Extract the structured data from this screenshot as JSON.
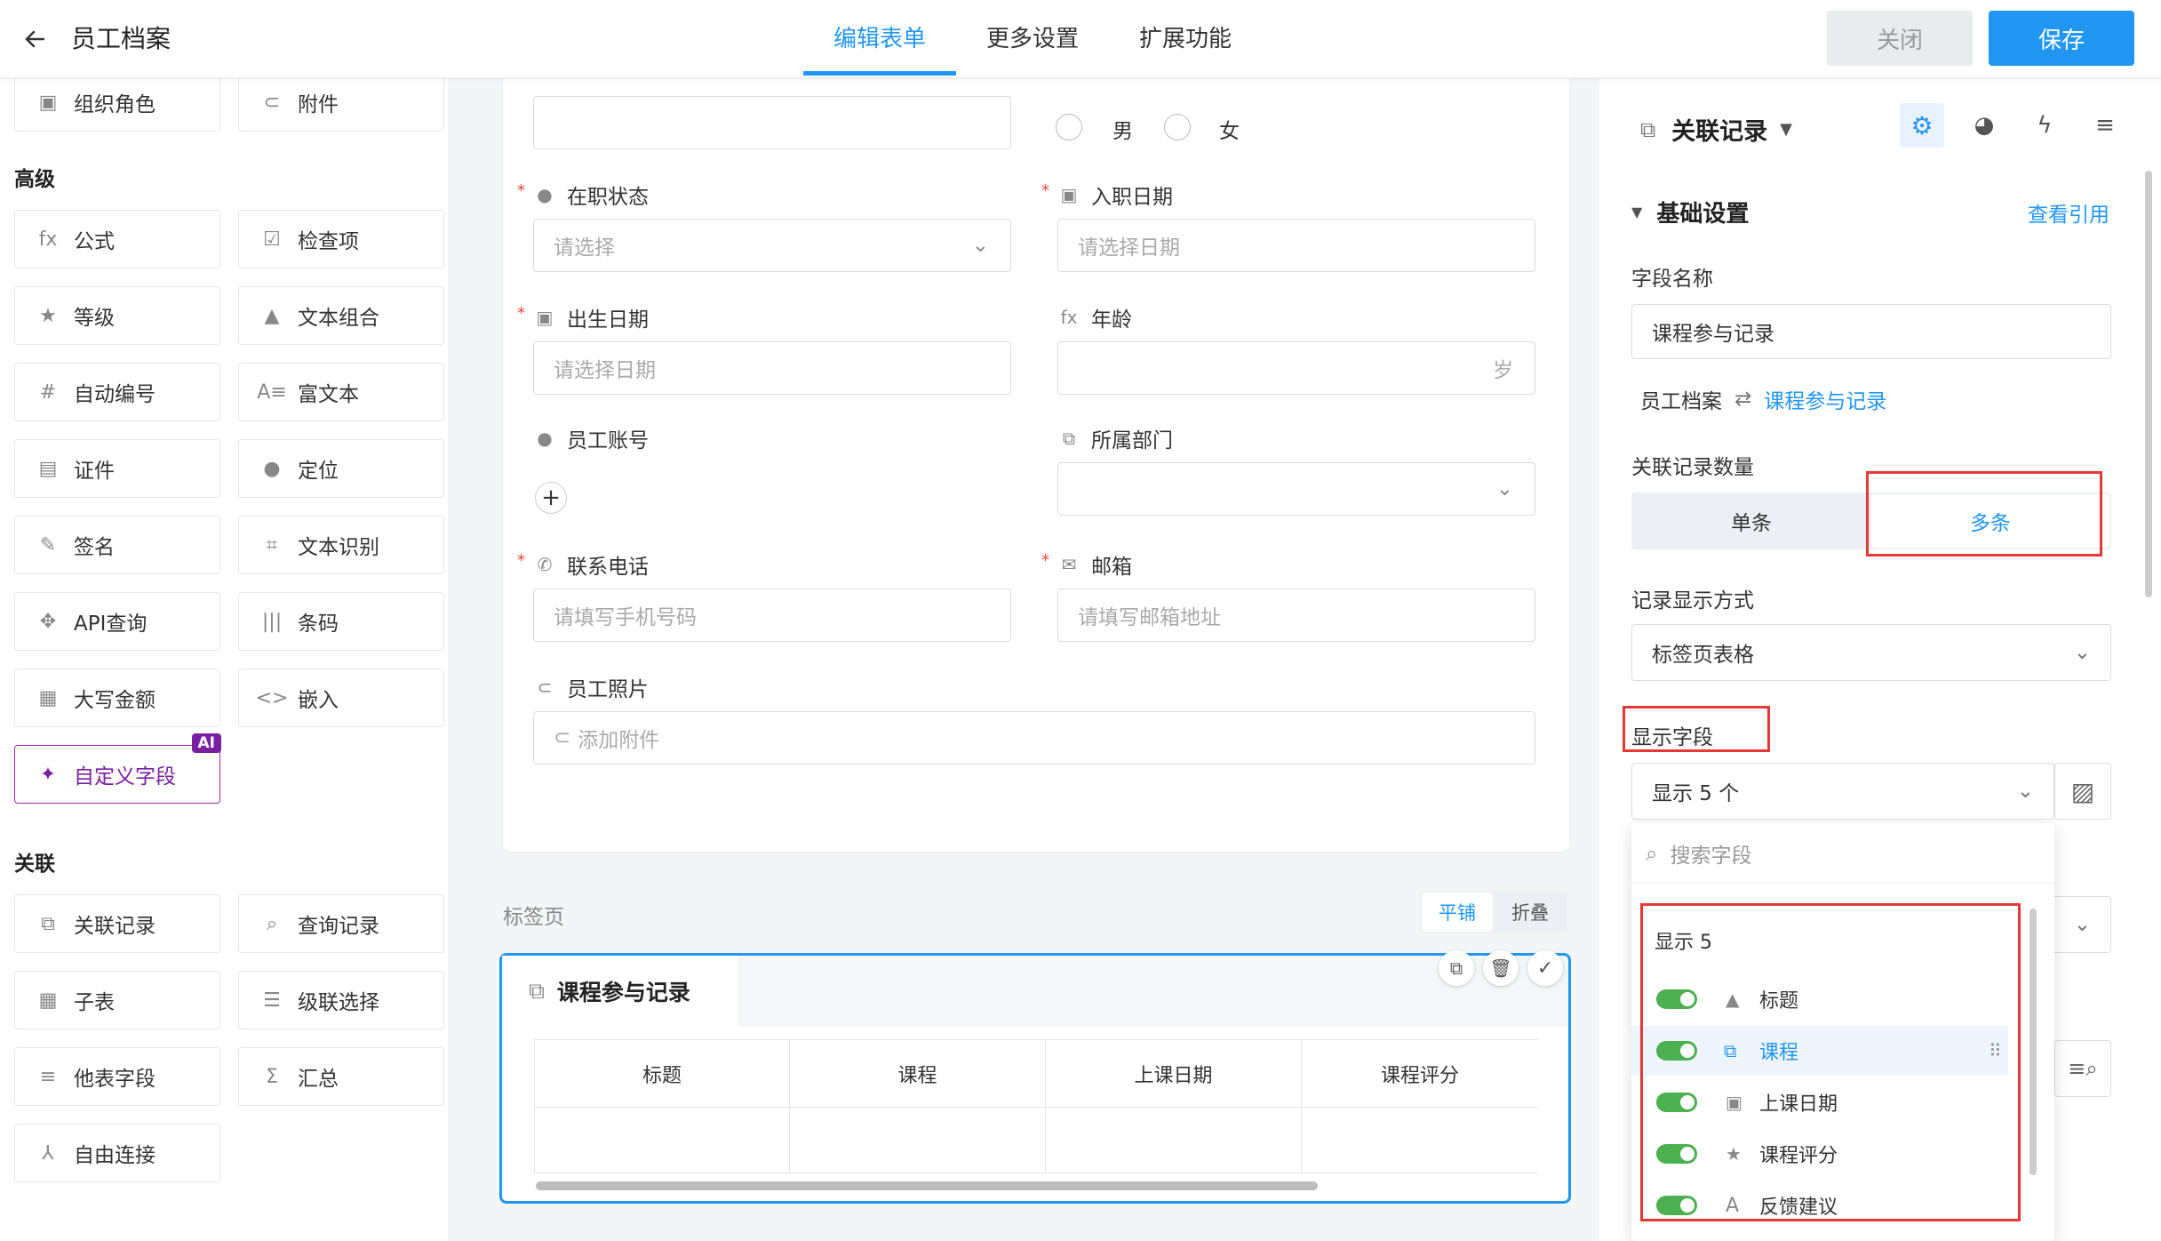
{
  "header": {
    "title": "员工档案",
    "tabs": [
      "编辑表单",
      "更多设置",
      "扩展功能"
    ],
    "close": "关闭",
    "save": "保存"
  },
  "left": {
    "top_items": [
      "组织角色",
      "附件"
    ],
    "sections": {
      "advanced": "高级",
      "relation": "关联"
    },
    "advanced_items": [
      "公式",
      "检查项",
      "等级",
      "文本组合",
      "自动编号",
      "富文本",
      "证件",
      "定位",
      "签名",
      "文本识别",
      "API查询",
      "条码",
      "大写金额",
      "嵌入",
      "自定义字段"
    ],
    "ai_badge": "AI",
    "relation_items": [
      "关联记录",
      "查询记录",
      "子表",
      "级联选择",
      "他表字段",
      "汇总",
      "自由连接"
    ]
  },
  "form": {
    "gender_options": [
      "男",
      "女"
    ],
    "fields": {
      "status": {
        "label": "在职状态",
        "placeholder": "请选择"
      },
      "hire_date": {
        "label": "入职日期",
        "placeholder": "请选择日期"
      },
      "birth": {
        "label": "出生日期",
        "placeholder": "请选择日期"
      },
      "age": {
        "label": "年龄",
        "suffix": "岁"
      },
      "account": {
        "label": "员工账号"
      },
      "dept": {
        "label": "所属部门"
      },
      "phone": {
        "label": "联系电话",
        "placeholder": "请填写手机号码"
      },
      "email": {
        "label": "邮箱",
        "placeholder": "请填写邮箱地址"
      },
      "photo": {
        "label": "员工照片",
        "placeholder": "添加附件"
      }
    },
    "tabpage": {
      "label": "标签页",
      "modes": [
        "平铺",
        "折叠"
      ],
      "section_title": "课程参与记录",
      "columns": [
        "标题",
        "课程",
        "上课日期",
        "课程评分"
      ]
    }
  },
  "right": {
    "field_type": "关联记录",
    "basic": "基础设置",
    "view_ref": "查看引用",
    "field_name_label": "字段名称",
    "field_name": "课程参与记录",
    "relation_from": "员工档案",
    "relation_to": "课程参与记录",
    "count_label": "关联记录数量",
    "count_options": [
      "单条",
      "多条"
    ],
    "display_mode_label": "记录显示方式",
    "display_mode": "标签页表格",
    "display_fields_label": "显示字段",
    "display_fields_value": "显示 5 个",
    "search_placeholder": "搜索字段",
    "shown_header": "显示 5",
    "shown_fields": [
      "标题",
      "课程",
      "上课日期",
      "课程评分",
      "反馈建议"
    ]
  },
  "colors": {
    "accent": "#2196f3",
    "highlight": "#e53935",
    "toggle_on": "#4caf50"
  }
}
